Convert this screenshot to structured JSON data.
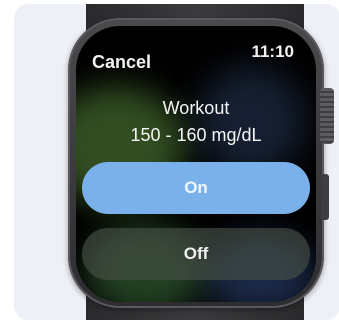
{
  "status": {
    "cancel_label": "Cancel",
    "time": "11:10"
  },
  "setting": {
    "title": "Workout",
    "range": "150 - 160 mg/dL"
  },
  "buttons": {
    "on_label": "On",
    "off_label": "Off"
  },
  "colors": {
    "on_button": "#7ab1ea",
    "screen": "#000000",
    "case": "#3a3a3d"
  }
}
